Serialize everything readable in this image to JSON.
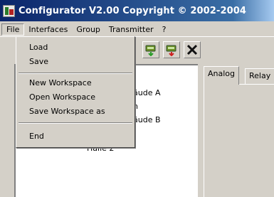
{
  "window": {
    "title": "Configurator  V2.00 Copyright © 2002-2004"
  },
  "menubar": {
    "items": [
      "File",
      "Interfaces",
      "Group",
      "Transmitter",
      "?"
    ]
  },
  "file_menu": {
    "items": [
      "Load",
      "Save",
      "New Workspace",
      "Open Workspace",
      "Save Workspace as",
      "End"
    ]
  },
  "toolbar": {
    "buttons": [
      {
        "icon": "transmitter-add-icon"
      },
      {
        "icon": "transmitter-remove-icon"
      },
      {
        "icon": "delete-icon"
      }
    ]
  },
  "tree": {
    "items": [
      "äude A",
      "n",
      "äude B",
      "Halle 2"
    ]
  },
  "tabs": [
    "Analog",
    "Relay"
  ],
  "colors": {
    "titlebar_start": "#0a246a",
    "titlebar_end": "#a6caf0",
    "face": "#d4d0c8",
    "icon_green": "#2a9d2a",
    "icon_red": "#cc2222"
  }
}
